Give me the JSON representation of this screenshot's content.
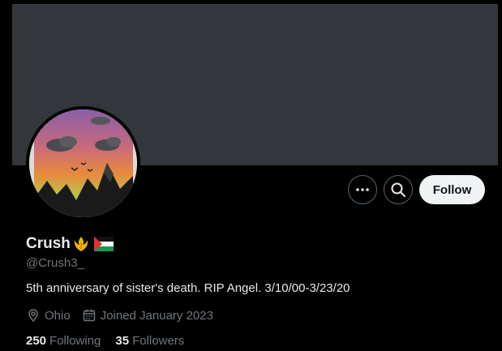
{
  "profile": {
    "display_name": "Crush",
    "handle": "@Crush3_",
    "bio": "5th anniversary of sister's death. RIP Angel. 3/10/00-3/23/20",
    "name_emojis": [
      "rebel-alliance-emoji",
      "palestine-flag-emoji"
    ]
  },
  "actions": {
    "more_icon": "more-horizontal-icon",
    "search_icon": "search-icon",
    "follow_label": "Follow"
  },
  "meta": {
    "location": "Ohio",
    "location_icon": "location-pin-icon",
    "joined": "Joined January 2023",
    "joined_icon": "calendar-icon"
  },
  "stats": {
    "following_count": "250",
    "following_label": "Following",
    "followers_count": "35",
    "followers_label": "Followers"
  },
  "colors": {
    "background": "#000000",
    "banner": "#33373b",
    "text_primary": "#e7e9ea",
    "text_secondary": "#71767b",
    "follow_button": "#eff3f4"
  }
}
